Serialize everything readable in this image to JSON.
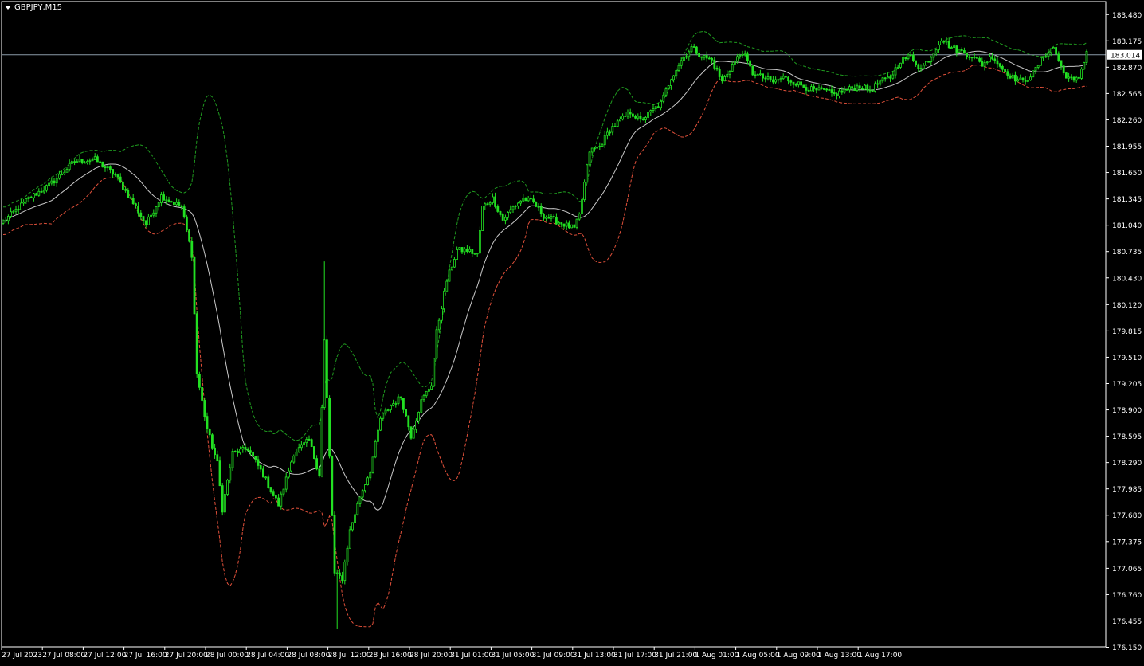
{
  "symbol_label": "GBPJPY,M15",
  "current_price_label": "183.014",
  "colors": {
    "background": "#000000",
    "candle": "#22e022",
    "middle_band": "#c8c8c8",
    "upper_band": "#1f9a1f",
    "lower_band": "#e0503a",
    "price_line": "#8a9aa8",
    "axis": "#ffffff",
    "price_tag_bg": "#ffffff",
    "price_tag_text": "#000000"
  },
  "chart_data": {
    "type": "candlestick",
    "indicator": "bollinger-bands",
    "grid": false,
    "ylim": [
      176.155,
      183.63
    ],
    "y_ticks": [
      183.48,
      183.175,
      182.87,
      182.565,
      182.26,
      181.955,
      181.65,
      181.345,
      181.04,
      180.735,
      180.43,
      180.12,
      179.815,
      179.51,
      179.205,
      178.9,
      178.595,
      178.29,
      177.985,
      177.68,
      177.375,
      177.065,
      176.76,
      176.455,
      176.15
    ],
    "y_tick_labels": [
      "183.480",
      "183.175",
      "182.870",
      "182.565",
      "182.260",
      "181.955",
      "181.650",
      "181.345",
      "181.040",
      "180.735",
      "180.430",
      "180.120",
      "179.815",
      "179.510",
      "179.205",
      "178.900",
      "178.595",
      "178.290",
      "177.985",
      "177.680",
      "177.375",
      "177.065",
      "176.760",
      "176.455",
      "176.150"
    ],
    "x_labels": [
      "27 Jul 2023",
      "27 Jul 08:00",
      "27 Jul 12:00",
      "27 Jul 16:00",
      "27 Jul 20:00",
      "28 Jul 00:00",
      "28 Jul 04:00",
      "28 Jul 08:00",
      "28 Jul 12:00",
      "28 Jul 16:00",
      "28 Jul 20:00",
      "31 Jul 01:00",
      "31 Jul 05:00",
      "31 Jul 09:00",
      "31 Jul 13:00",
      "31 Jul 17:00",
      "31 Jul 21:00",
      "1 Aug 01:00",
      "1 Aug 05:00",
      "1 Aug 09:00",
      "1 Aug 13:00",
      "1 Aug 17:00"
    ],
    "bars_per_label": 16,
    "current_price": 183.014,
    "close_keypoints": [
      [
        0,
        181.08
      ],
      [
        10,
        181.35
      ],
      [
        18,
        181.5
      ],
      [
        28,
        181.78
      ],
      [
        36,
        181.8
      ],
      [
        44,
        181.62
      ],
      [
        52,
        181.25
      ],
      [
        56,
        181.05
      ],
      [
        62,
        181.38
      ],
      [
        70,
        181.25
      ],
      [
        74,
        180.7
      ],
      [
        76,
        179.32
      ],
      [
        80,
        178.68
      ],
      [
        84,
        178.28
      ],
      [
        86,
        177.75
      ],
      [
        90,
        178.4
      ],
      [
        96,
        178.45
      ],
      [
        102,
        178.15
      ],
      [
        108,
        177.8
      ],
      [
        114,
        178.4
      ],
      [
        120,
        178.55
      ],
      [
        124,
        178.15
      ],
      [
        126,
        179.7
      ],
      [
        130,
        177.0
      ],
      [
        133,
        176.95
      ],
      [
        136,
        177.5
      ],
      [
        140,
        177.9
      ],
      [
        144,
        178.2
      ],
      [
        148,
        178.8
      ],
      [
        152,
        178.95
      ],
      [
        156,
        179.05
      ],
      [
        160,
        178.6
      ],
      [
        164,
        179.0
      ],
      [
        168,
        179.2
      ],
      [
        170,
        179.8
      ],
      [
        174,
        180.4
      ],
      [
        178,
        180.75
      ],
      [
        182,
        180.75
      ],
      [
        186,
        180.7
      ],
      [
        188,
        181.25
      ],
      [
        192,
        181.35
      ],
      [
        196,
        181.1
      ],
      [
        200,
        181.25
      ],
      [
        204,
        181.35
      ],
      [
        208,
        181.3
      ],
      [
        212,
        181.15
      ],
      [
        216,
        181.1
      ],
      [
        220,
        181.05
      ],
      [
        224,
        181.0
      ],
      [
        226,
        181.15
      ],
      [
        230,
        181.9
      ],
      [
        234,
        181.95
      ],
      [
        238,
        182.15
      ],
      [
        242,
        182.25
      ],
      [
        246,
        182.35
      ],
      [
        250,
        182.25
      ],
      [
        254,
        182.35
      ],
      [
        258,
        182.45
      ],
      [
        262,
        182.75
      ],
      [
        266,
        182.95
      ],
      [
        270,
        183.1
      ],
      [
        274,
        183.0
      ],
      [
        278,
        182.95
      ],
      [
        282,
        182.7
      ],
      [
        286,
        182.9
      ],
      [
        290,
        183.05
      ],
      [
        294,
        182.8
      ],
      [
        298,
        182.75
      ],
      [
        302,
        182.7
      ],
      [
        306,
        182.75
      ],
      [
        310,
        182.7
      ],
      [
        314,
        182.65
      ],
      [
        318,
        182.6
      ],
      [
        322,
        182.6
      ],
      [
        326,
        182.55
      ],
      [
        330,
        182.6
      ],
      [
        336,
        182.65
      ],
      [
        340,
        182.6
      ],
      [
        344,
        182.7
      ],
      [
        348,
        182.75
      ],
      [
        352,
        182.95
      ],
      [
        356,
        183.0
      ],
      [
        360,
        182.85
      ],
      [
        364,
        183.0
      ],
      [
        368,
        183.2
      ],
      [
        372,
        183.1
      ],
      [
        376,
        183.05
      ],
      [
        380,
        183.0
      ],
      [
        384,
        182.9
      ],
      [
        388,
        183.0
      ],
      [
        392,
        182.85
      ],
      [
        396,
        182.75
      ],
      [
        400,
        182.7
      ],
      [
        404,
        182.8
      ],
      [
        408,
        183.0
      ],
      [
        412,
        183.1
      ],
      [
        416,
        182.8
      ],
      [
        420,
        182.7
      ],
      [
        422,
        182.75
      ],
      [
        425,
        183.05
      ]
    ],
    "bollinger_period": 20,
    "bollinger_deviation": 2
  }
}
